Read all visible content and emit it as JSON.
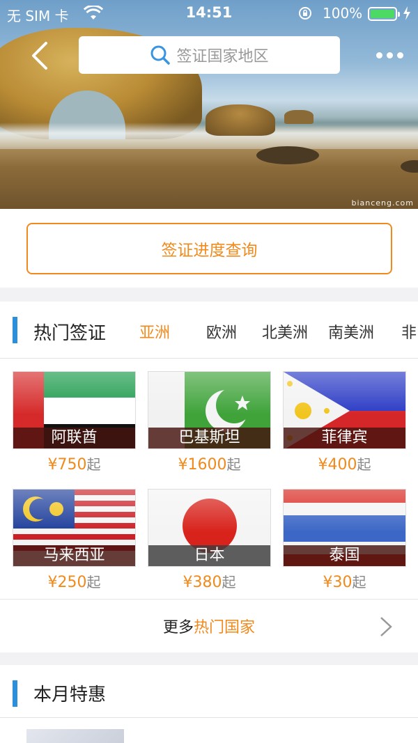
{
  "status_bar": {
    "carrier": "无 SIM 卡",
    "time": "14:51",
    "battery_percent": "100%"
  },
  "hero": {
    "watermark": "bianceng.com"
  },
  "nav": {
    "search_placeholder": "签证国家地区"
  },
  "progress_button": "签证进度查询",
  "hot_visa": {
    "title": "热门签证",
    "tabs": [
      "亚洲",
      "欧洲",
      "北美洲",
      "南美洲",
      "非"
    ],
    "active_tab": "亚洲",
    "countries": [
      {
        "name": "阿联酋",
        "price": "¥750",
        "suffix": "起"
      },
      {
        "name": "巴基斯坦",
        "price": "¥1600",
        "suffix": "起"
      },
      {
        "name": "菲律宾",
        "price": "¥400",
        "suffix": "起"
      },
      {
        "name": "马来西亚",
        "price": "¥250",
        "suffix": "起"
      },
      {
        "name": "日本",
        "price": "¥380",
        "suffix": "起"
      },
      {
        "name": "泰国",
        "price": "¥30",
        "suffix": "起"
      }
    ],
    "more_prefix": "更多",
    "more_highlight": "热门国家"
  },
  "monthly": {
    "title": "本月特惠"
  },
  "colors": {
    "accent": "#f08a1c",
    "section_bar": "#2c8fdb"
  }
}
